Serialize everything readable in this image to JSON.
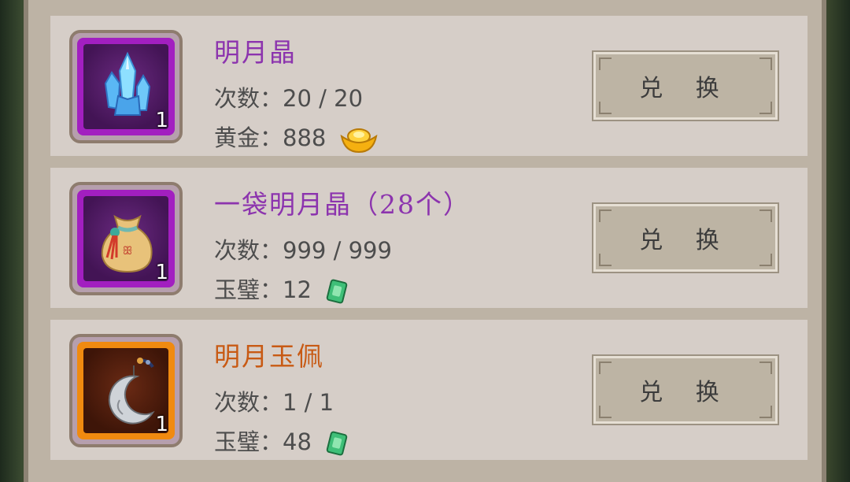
{
  "items": [
    {
      "name": "明月晶",
      "count_label": "次数：",
      "count_value": "20 / 20",
      "price_label": "黄金：",
      "price_value": "888",
      "currency_icon": "gold-ingot-icon",
      "icon": "crystal-icon",
      "icon_count": "1",
      "button_label": "兑 换",
      "rarity_color": "#8c34ae"
    },
    {
      "name": "一袋明月晶（28个）",
      "count_label": "次数：",
      "count_value": "999 / 999",
      "price_label": "玉璧：",
      "price_value": "12",
      "currency_icon": "jade-icon",
      "icon": "bag-icon",
      "icon_count": "1",
      "button_label": "兑 换",
      "rarity_color": "#8c34ae"
    },
    {
      "name": "明月玉佩",
      "count_label": "次数：",
      "count_value": "1 / 1",
      "price_label": "玉璧：",
      "price_value": "48",
      "currency_icon": "jade-icon",
      "icon": "moon-pendant-icon",
      "icon_count": "1",
      "button_label": "兑 换",
      "rarity_color": "#c85a14"
    }
  ]
}
